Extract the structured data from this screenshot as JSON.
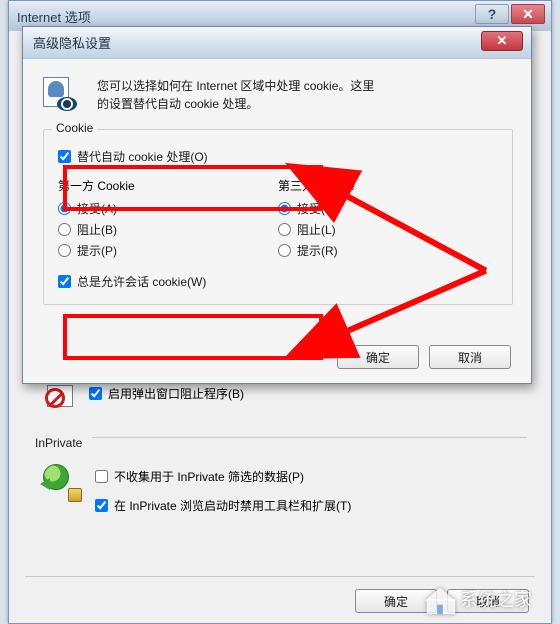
{
  "outer_window": {
    "title": "Internet 选项",
    "help_icon_char": "?",
    "close_icon_char": "✕"
  },
  "inner_dialog": {
    "title": "高级隐私设置",
    "close_char": "✕",
    "info_text_line1": "您可以选择如何在 Internet 区域中处理 cookie。这里",
    "info_text_line2": "的设置替代自动 cookie 处理。"
  },
  "cookie_group": {
    "title": "Cookie",
    "override_label": "替代自动 cookie 处理(O)",
    "first_party_heading": "第一方 Cookie",
    "third_party_heading": "第三方 Cookie",
    "accept_a": "接受(A)",
    "block_b": "阻止(B)",
    "prompt_p": "提示(P)",
    "accept_c": "接受(C)",
    "block_l": "阻止(L)",
    "prompt_r": "提示(R)",
    "always_allow_session": "总是允许会话 cookie(W)"
  },
  "dialog_buttons": {
    "ok": "确定",
    "cancel": "取消"
  },
  "below": {
    "popup_blocker_label": "启用弹出窗口阻止程序(B)",
    "inprivate_heading": "InPrivate",
    "inprivate_collect": "不收集用于 InPrivate 筛选的数据(P)",
    "inprivate_disable": "在 InPrivate 浏览启动时禁用工具栏和扩展(T)"
  },
  "outer_buttons": {
    "ok": "确定",
    "cancel": "取消"
  },
  "watermark": {
    "text": "系统之家"
  }
}
